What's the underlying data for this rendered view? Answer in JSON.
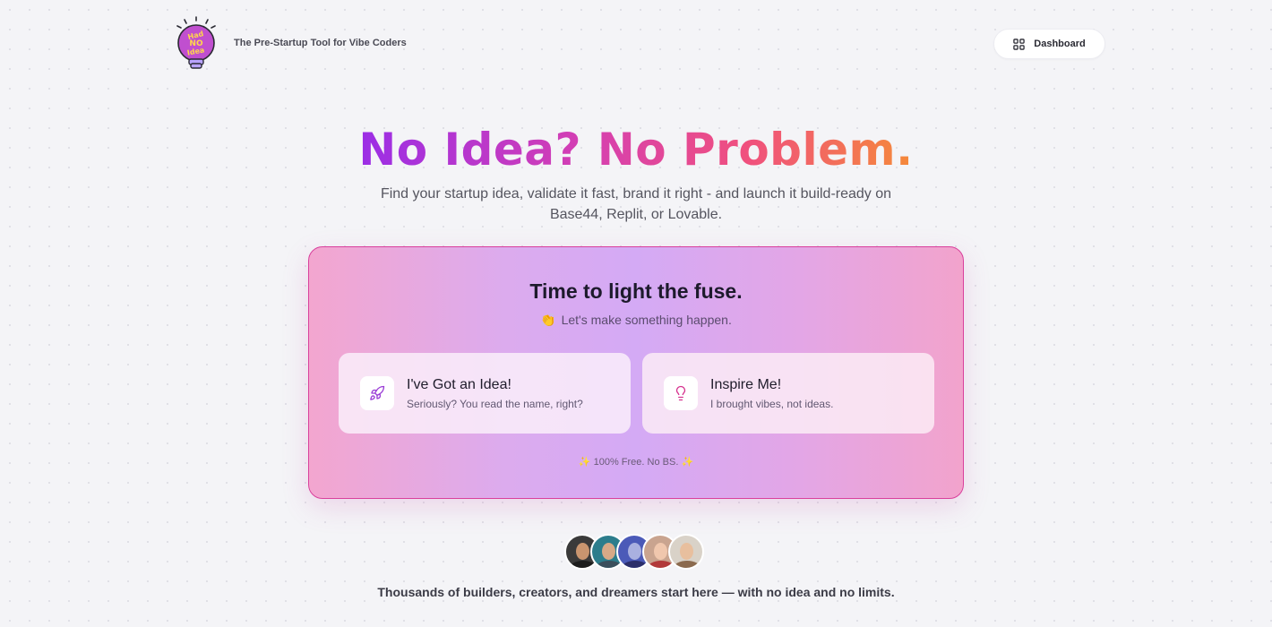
{
  "header": {
    "logo_text": "Had NO Idea",
    "tagline": "The Pre-Startup Tool for Vibe Coders",
    "dashboard_label": "Dashboard",
    "dashboard_icon": "grid-icon"
  },
  "hero": {
    "title": "No Idea? No Problem.",
    "subtitle": "Find your startup idea, validate it fast, brand it right - and launch it build-ready on Base44, Replit, or Lovable.",
    "gradient_colors": [
      "#9b2ee6",
      "#d43fb3",
      "#f0507e",
      "#f58a3a"
    ]
  },
  "card": {
    "title": "Time to light the fuse.",
    "subtitle_emoji": "👏",
    "subtitle": "Let's make something happen.",
    "options": [
      {
        "title": "I've Got an Idea!",
        "description": "Seriously? You read the name, right?",
        "icon": "rocket-icon"
      },
      {
        "title": "Inspire Me!",
        "description": "I brought vibes, not ideas.",
        "icon": "lightbulb-icon"
      }
    ],
    "footer_spark": "✨",
    "footer": "100% Free. No BS."
  },
  "social_proof": {
    "avatar_count": 5,
    "text": "Thousands of builders, creators, and dreamers start here — with no idea and no limits."
  }
}
